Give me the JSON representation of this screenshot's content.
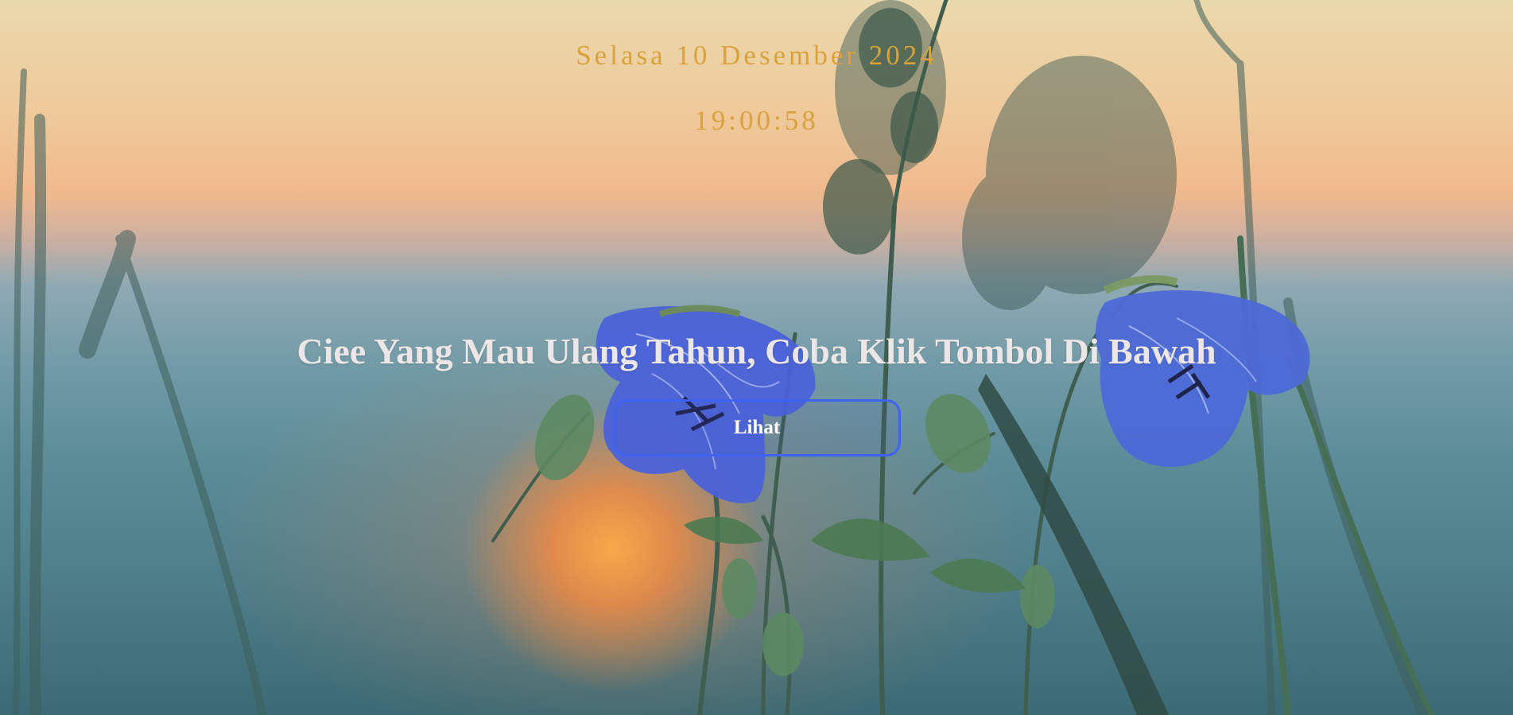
{
  "page": {
    "date_text": "Selasa 10 Desember 2024",
    "time_text": "19:00:58",
    "headline": "Ciee Yang Mau Ulang Tahun, Coba Klik Tombol Di Bawah",
    "button_label": "Lihat"
  },
  "colors": {
    "clock_text": "#d9a23c",
    "headline_text": "#ece6e6",
    "button_border": "#3f63f0",
    "button_text": "#ffffff"
  },
  "background": {
    "description_icon": "sunset-flowers-photo"
  }
}
